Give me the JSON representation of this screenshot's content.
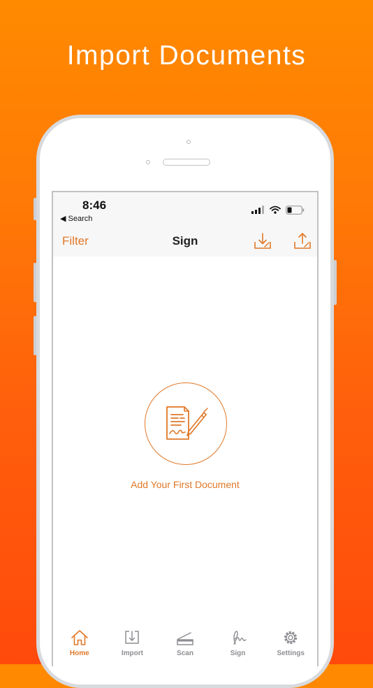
{
  "headline": "Import Documents",
  "status_bar": {
    "time": "8:46",
    "back_label": "◀ Search"
  },
  "nav_bar": {
    "left_label": "Filter",
    "title": "Sign",
    "right_icons": [
      "download-icon",
      "upload-icon"
    ]
  },
  "empty_state": {
    "icon": "document-sign-icon",
    "label": "Add Your First Document"
  },
  "tab_bar": {
    "active": "Home",
    "items": [
      {
        "label": "Home",
        "icon": "home-icon"
      },
      {
        "label": "Import",
        "icon": "import-icon"
      },
      {
        "label": "Scan",
        "icon": "scan-icon"
      },
      {
        "label": "Sign",
        "icon": "signature-icon"
      },
      {
        "label": "Settings",
        "icon": "gear-icon"
      }
    ]
  },
  "colors": {
    "accent": "#E07828",
    "background_top": "#FF8A00",
    "background_bottom": "#FF4A0C",
    "inactive_tab": "#8E8E93"
  }
}
